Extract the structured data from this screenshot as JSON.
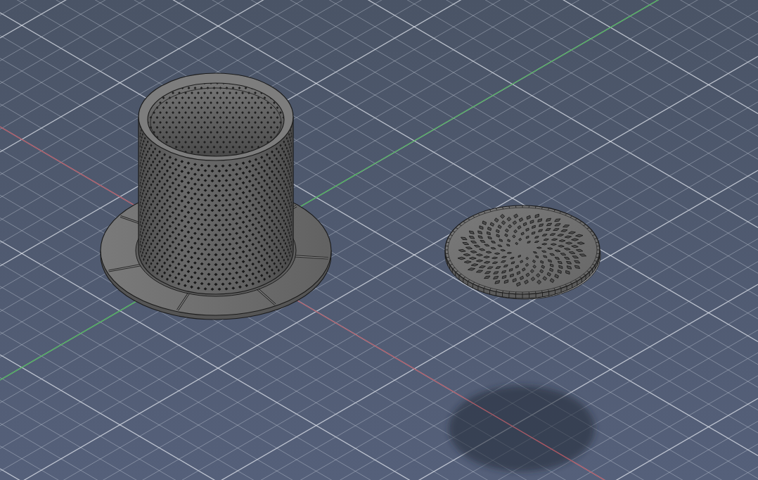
{
  "viewport": {
    "axes": [
      {
        "kind": "x",
        "color": "#b0505c"
      },
      {
        "kind": "y",
        "color": "#43b04f"
      }
    ],
    "models": [
      {
        "kind": "basket"
      },
      {
        "kind": "disc",
        "shadow": true
      }
    ]
  }
}
